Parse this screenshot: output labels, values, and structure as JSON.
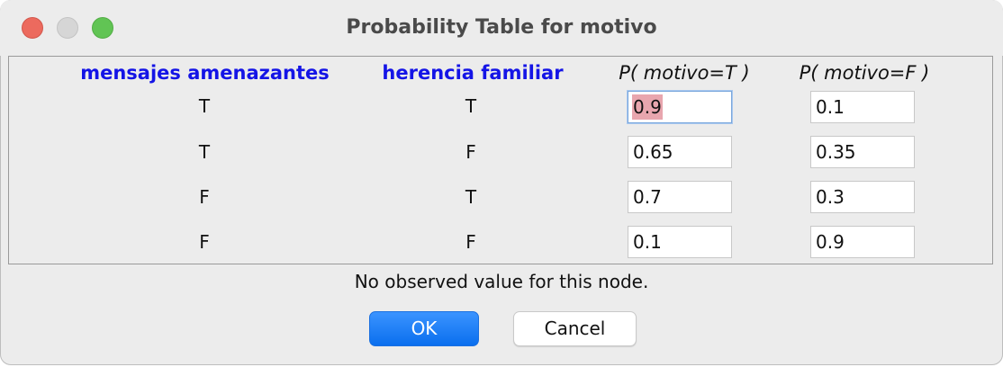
{
  "window": {
    "title": "Probability Table for motivo"
  },
  "table": {
    "headers": {
      "parent1": "mensajes amenazantes",
      "parent2": "herencia familiar",
      "prob_true": "P( motivo=T )",
      "prob_false": "P( motivo=F )"
    },
    "rows": [
      {
        "p1": "T",
        "p2": "T",
        "pt": "0.9",
        "pf": "0.1"
      },
      {
        "p1": "T",
        "p2": "F",
        "pt": "0.65",
        "pf": "0.35"
      },
      {
        "p1": "F",
        "p2": "T",
        "pt": "0.7",
        "pf": "0.3"
      },
      {
        "p1": "F",
        "p2": "F",
        "pt": "0.1",
        "pf": "0.9"
      }
    ]
  },
  "status": "No observed value for this node.",
  "buttons": {
    "ok": "OK",
    "cancel": "Cancel"
  },
  "colors": {
    "parent_header": "#1414e6",
    "ok_button": "#0a6fee",
    "selection_highlight": "#e8a6ae"
  }
}
